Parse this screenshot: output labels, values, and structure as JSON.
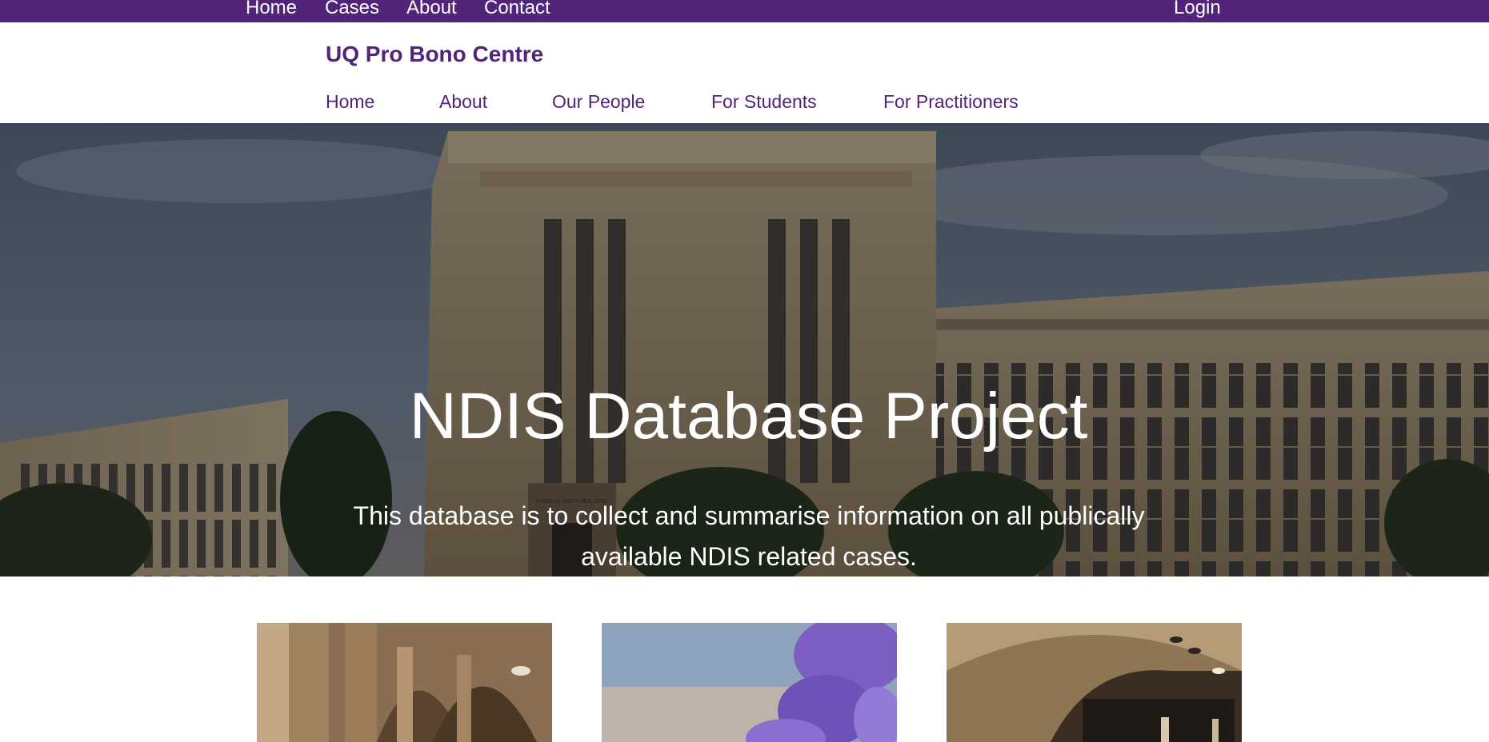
{
  "topbar": {
    "links": [
      "Home",
      "Cases",
      "About",
      "Contact"
    ],
    "login": "Login"
  },
  "header": {
    "brand": "UQ Pro Bono Centre",
    "nav": [
      "Home",
      "About",
      "Our People",
      "For Students",
      "For Practitioners"
    ]
  },
  "hero": {
    "title": "NDIS Database Project",
    "subtitle": "This database is to collect and summarise information on all publically available NDIS related cases.",
    "building_sign": "FORGAN SMITH BUILDING",
    "image": "forgan-smith-building-photo"
  },
  "cards": [
    {
      "image": "sandstone-cloisters-photo"
    },
    {
      "image": "jacaranda-flowers-photo"
    },
    {
      "image": "library-interior-photo"
    }
  ],
  "colors": {
    "brand": "#51247a",
    "white": "#ffffff",
    "hero_overlay": "rgba(0,0,0,0.35)"
  }
}
